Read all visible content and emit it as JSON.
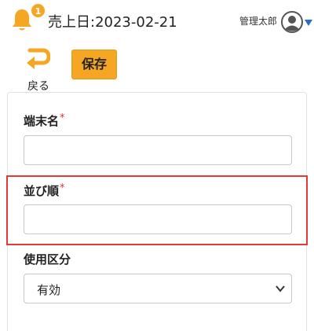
{
  "header": {
    "notification_count": "1",
    "sales_date": "売上日:2023-02-21",
    "user_name": "管理太郎",
    "accent_color": "#f5a623"
  },
  "toolbar": {
    "back_label": "戻る",
    "save_label": "保存"
  },
  "form": {
    "terminal_name": {
      "label": "端末名",
      "required_mark": "*",
      "value": ""
    },
    "sort_order": {
      "label": "並び順",
      "required_mark": "*",
      "value": ""
    },
    "usage_type": {
      "label": "使用区分",
      "selected": "有効"
    }
  },
  "highlight_color": "#e53935"
}
